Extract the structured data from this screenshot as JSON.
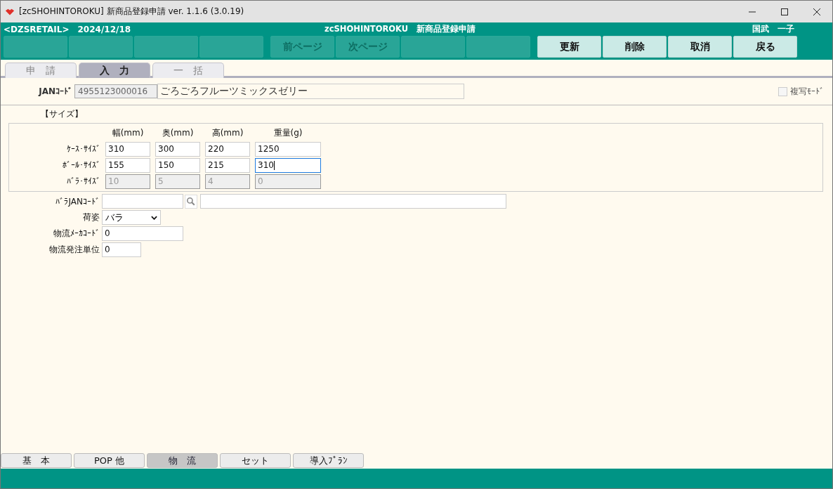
{
  "window": {
    "title": "[zcSHOHINTOROKU] 新商品登録申請 ver. 1.1.6 (3.0.19)"
  },
  "header": {
    "company": "<DZSRETAIL>",
    "date": "2024/12/18",
    "screen": "zcSHOHINTOROKU　新商品登録申請",
    "user": "国武　一子"
  },
  "function_keys": [
    {
      "disabled": true
    },
    {
      "disabled": true
    },
    {
      "disabled": true
    },
    {
      "disabled": true
    },
    {
      "label": "前ページ",
      "disabled": true
    },
    {
      "label": "次ページ",
      "disabled": true
    },
    {
      "disabled": true
    },
    {
      "disabled": true
    },
    {
      "label": "更新",
      "disabled": false
    },
    {
      "label": "削除",
      "disabled": false
    },
    {
      "label": "取消",
      "disabled": false
    },
    {
      "label": "戻る",
      "disabled": false
    }
  ],
  "top_tabs": [
    {
      "label": "申　請",
      "selected": false
    },
    {
      "label": "入　力",
      "selected": true
    },
    {
      "label": "一　括",
      "selected": false
    }
  ],
  "jan": {
    "label": "JANｺｰﾄﾞ",
    "code": "4955123000016",
    "name": "ごろごろフルーツミックスゼリー"
  },
  "copy_mode": {
    "label": "複写ﾓｰﾄﾞ",
    "checked": false
  },
  "size_section": {
    "title": "【サイズ】",
    "columns": [
      "幅(mm)",
      "奥(mm)",
      "高(mm)",
      "重量(g)"
    ],
    "rows": [
      {
        "label": "ｹｰｽ･ｻｲｽﾞ",
        "cells": [
          {
            "value": "310",
            "disabled": false,
            "focused": false
          },
          {
            "value": "300",
            "disabled": false,
            "focused": false
          },
          {
            "value": "220",
            "disabled": false,
            "focused": false
          },
          {
            "value": "1250",
            "disabled": false,
            "focused": false
          }
        ]
      },
      {
        "label": "ﾎﾞｰﾙ･ｻｲｽﾞ",
        "cells": [
          {
            "value": "155",
            "disabled": false,
            "focused": false
          },
          {
            "value": "150",
            "disabled": false,
            "focused": false
          },
          {
            "value": "215",
            "disabled": false,
            "focused": false
          },
          {
            "value": "310",
            "disabled": false,
            "focused": true
          }
        ]
      },
      {
        "label": "ﾊﾞﾗ･ｻｲｽﾞ",
        "cells": [
          {
            "value": "10",
            "disabled": true,
            "focused": false
          },
          {
            "value": "5",
            "disabled": true,
            "focused": false
          },
          {
            "value": "4",
            "disabled": true,
            "focused": false
          },
          {
            "value": "0",
            "disabled": true,
            "focused": false
          }
        ]
      }
    ]
  },
  "bara_jan": {
    "label": "ﾊﾞﾗJANｺｰﾄﾞ"
  },
  "packing": {
    "label": "荷姿",
    "value": "バラ"
  },
  "maker_code": {
    "label": "物流ﾒｰｶｺｰﾄﾞ",
    "value": "0"
  },
  "order_unit": {
    "label": "物流発注単位",
    "value": "0"
  },
  "bottom_tabs": [
    {
      "label": "基　本",
      "selected": false
    },
    {
      "label": "POP 他",
      "selected": false
    },
    {
      "label": "物　流",
      "selected": true
    },
    {
      "label": "セット",
      "selected": false
    },
    {
      "label": "導入ﾌﾟﾗﾝ",
      "selected": false
    }
  ]
}
